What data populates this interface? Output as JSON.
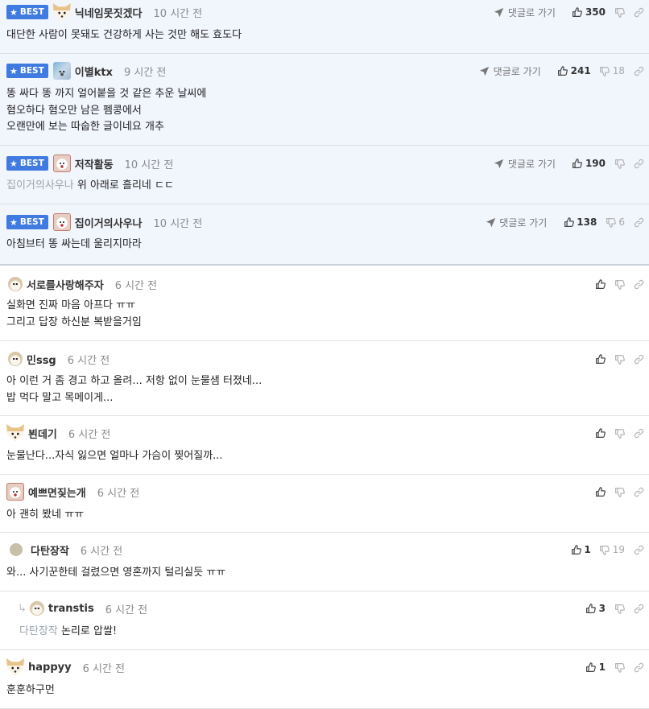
{
  "ui": {
    "best_label": "BEST",
    "reply_go": "댓글로 가기"
  },
  "icons": [
    "star-icon",
    "reply-go-icon",
    "thumbs-up-icon",
    "thumbs-down-icon",
    "link-icon",
    "reply-arrow-icon"
  ],
  "colors": {
    "best_bg": "#f1f5fc",
    "badge": "#3f7be0",
    "mention": "#9aa3ad"
  },
  "comments": [
    {
      "best": true,
      "nick": "닉네임못짓겠다",
      "time": "10 시간 전",
      "likes": "350",
      "dislikes": "",
      "text": "대단한 사람이 못돼도 건강하게 사는 것만 해도 효도다",
      "mention": ""
    },
    {
      "best": true,
      "nick": "이별ktx",
      "time": "9 시간 전",
      "likes": "241",
      "dislikes": "18",
      "text": "똥 싸다 똥 까지 얼어붙을 것 같은 추운 날씨에\n혐오하다 혐오만 남은 펨콩에서\n오랜만에 보는 따숩한 글이네요 개추",
      "mention": ""
    },
    {
      "best": true,
      "nick": "저작활동",
      "time": "10 시간 전",
      "likes": "190",
      "dislikes": "",
      "text": "위 아래로 흘리네 ㄷㄷ",
      "mention": "집이거의사우나"
    },
    {
      "best": true,
      "nick": "집이거의사우나",
      "time": "10 시간 전",
      "likes": "138",
      "dislikes": "6",
      "text": "아침브터 똥 싸는데 울리지마라",
      "mention": ""
    },
    {
      "best": false,
      "nick": "서로를사랑해주자",
      "time": "6 시간 전",
      "likes": "",
      "dislikes": "",
      "text": "실화면 진짜 마음 아프다 ㅠㅠ\n그리고 답장 하신분 복받을거임",
      "mention": ""
    },
    {
      "best": false,
      "nick": "민ssg",
      "time": "6 시간 전",
      "likes": "",
      "dislikes": "",
      "text": "아 이런 거 좀 경고 하고 올려... 저항 없이 눈물샘 터졌네...\n밥 먹다 말고 목메이게...",
      "mention": ""
    },
    {
      "best": false,
      "nick": "뵌데기",
      "time": "6 시간 전",
      "likes": "",
      "dislikes": "",
      "text": "눈물난다...자식 잃으면 얼마나 가슴이 찢어질까...",
      "mention": ""
    },
    {
      "best": false,
      "nick": "예쁘면짖는개",
      "time": "6 시간 전",
      "likes": "",
      "dislikes": "",
      "text": "아 괜히 봤네 ㅠㅠ",
      "mention": ""
    },
    {
      "best": false,
      "nick": "다탄장작",
      "time": "6 시간 전",
      "likes": "1",
      "dislikes": "19",
      "text": "와... 사기꾼한테 걸렸으면 영혼까지 털리실듯 ㅠㅠ",
      "mention": ""
    },
    {
      "best": false,
      "nick": "transtis",
      "time": "6 시간 전",
      "likes": "3",
      "dislikes": "",
      "text": "논리로 압쌀!",
      "mention": "다탄장작"
    },
    {
      "best": false,
      "nick": "happyy",
      "time": "6 시간 전",
      "likes": "1",
      "dislikes": "",
      "text": "훈훈하구먼",
      "mention": ""
    }
  ]
}
